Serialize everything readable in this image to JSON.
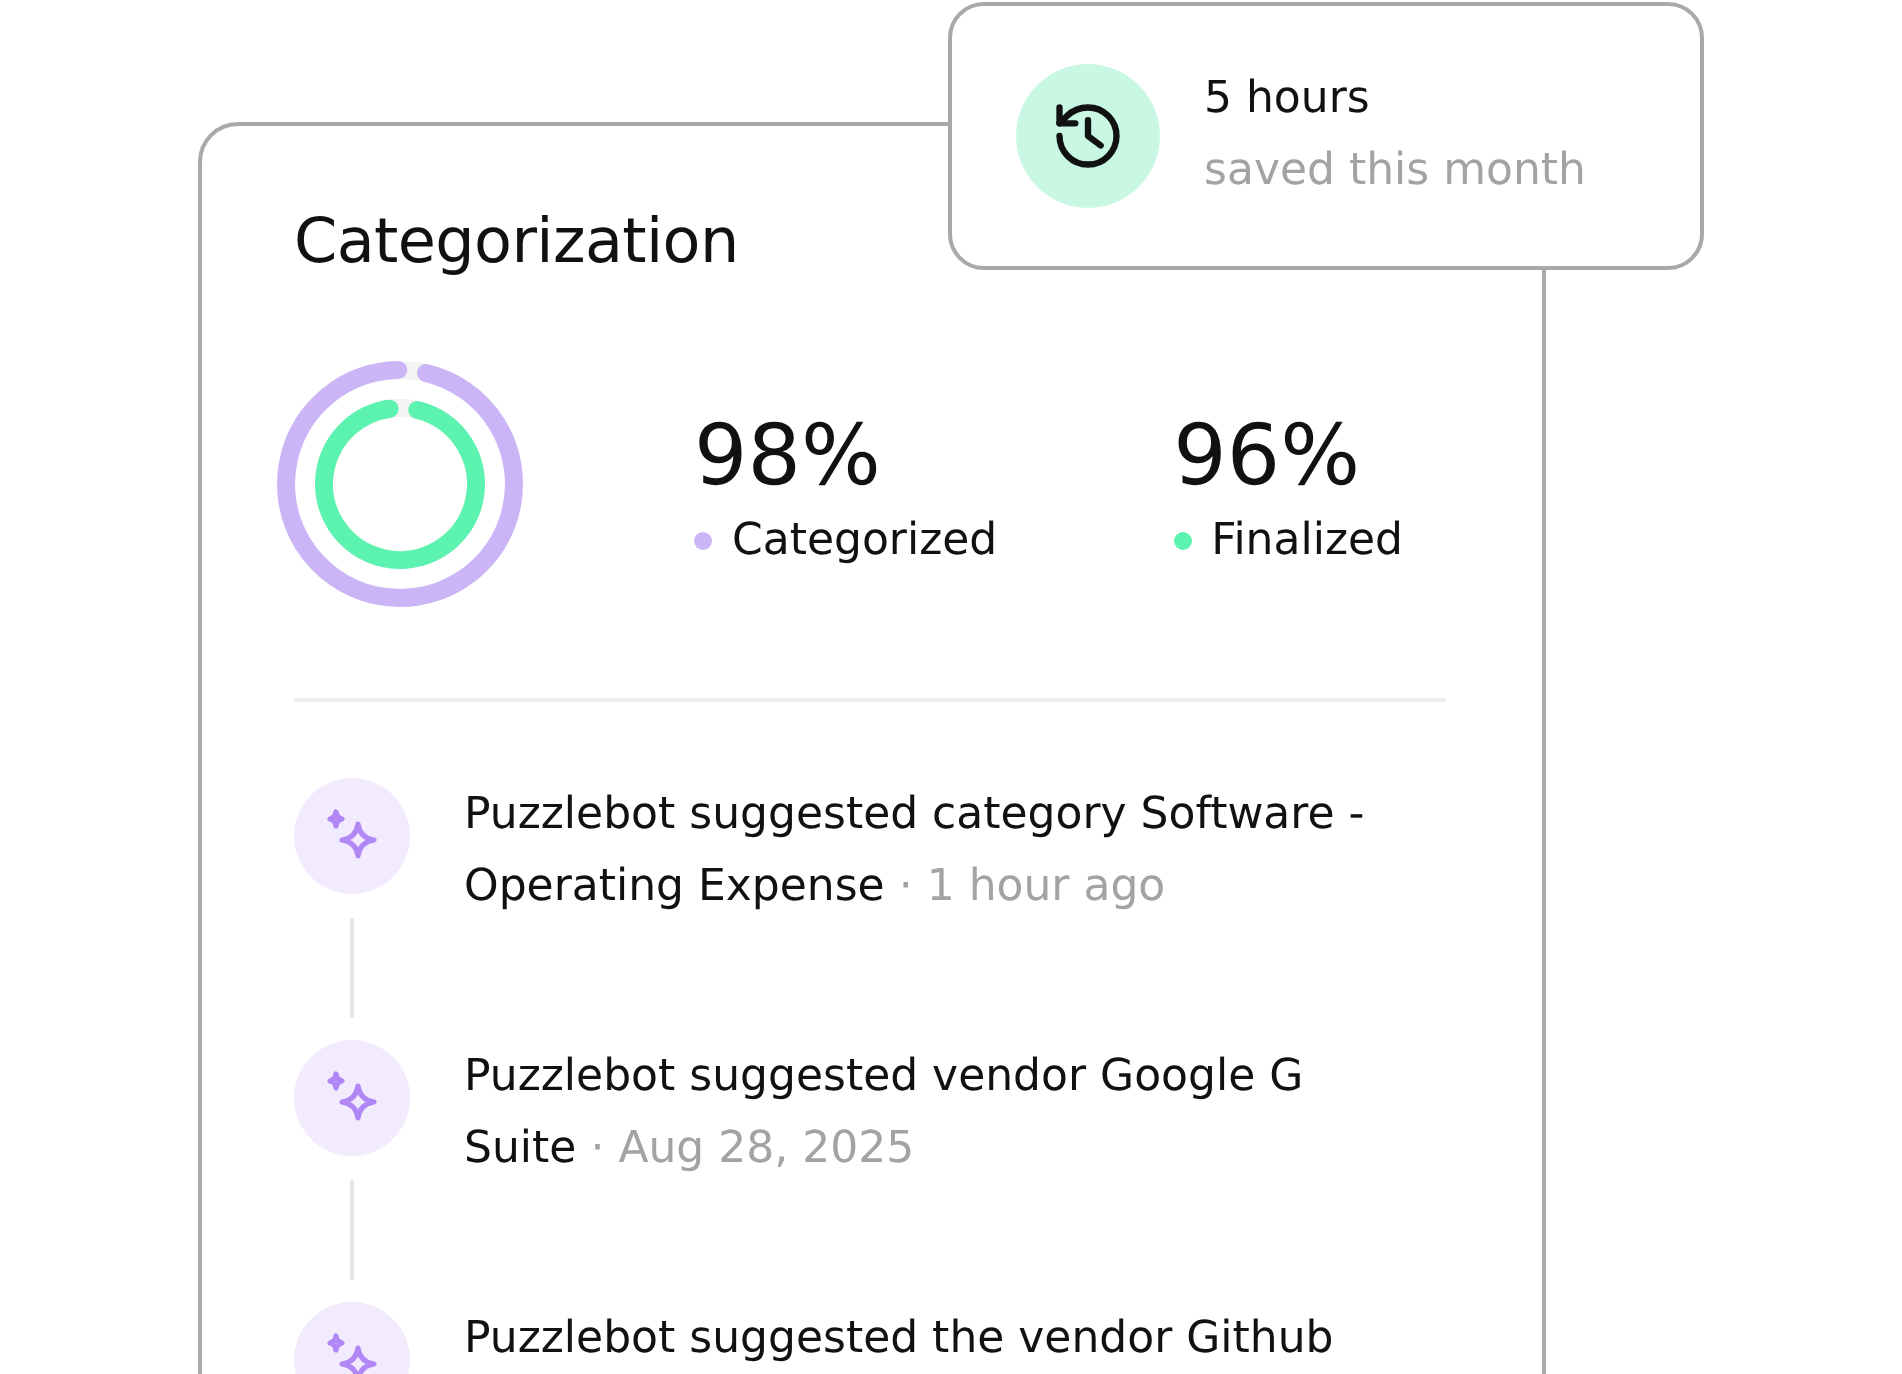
{
  "card": {
    "title": "Categorization",
    "donut": {
      "rings": [
        {
          "level": 0.98
        },
        {
          "level": 0.96
        }
      ]
    },
    "stats": [
      {
        "value": "98%",
        "label": "Categorized",
        "color": "#cbb5f7"
      },
      {
        "value": "96%",
        "label": "Finalized",
        "color": "#5cf2b0"
      }
    ],
    "activity": [
      {
        "text": "Puzzlebot suggested category Software - Operating Expense",
        "separator": "·",
        "time": "1 hour ago"
      },
      {
        "text": "Puzzlebot suggested vendor Google G Suite",
        "separator": "·",
        "time": "Aug 28, 2025"
      },
      {
        "text": "Puzzlebot suggested the vendor Github"
      }
    ]
  },
  "savings": {
    "value": "5 hours",
    "caption": "saved this month"
  }
}
